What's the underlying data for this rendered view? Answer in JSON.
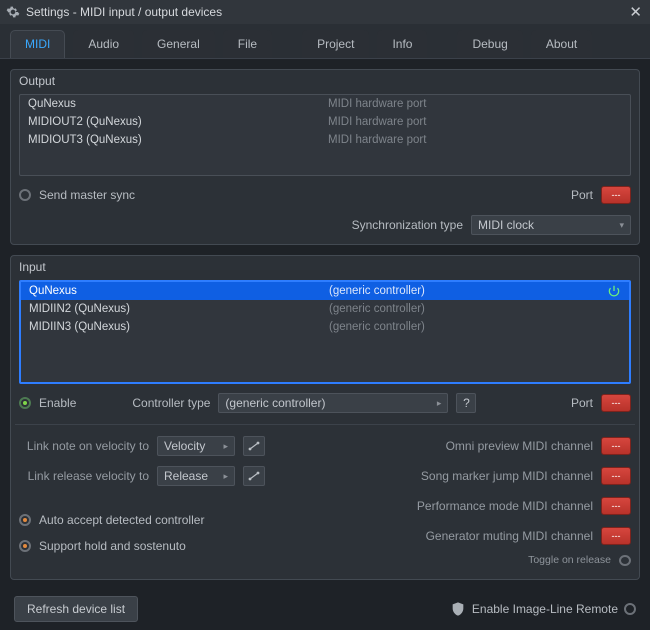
{
  "title": "Settings - MIDI input / output devices",
  "tabs": [
    "MIDI",
    "Audio",
    "General",
    "File",
    "Project",
    "Info",
    "Debug",
    "About"
  ],
  "active_tab": "MIDI",
  "output": {
    "title": "Output",
    "rows": [
      {
        "name": "QuNexus",
        "desc": "MIDI hardware port"
      },
      {
        "name": "MIDIOUT2 (QuNexus)",
        "desc": "MIDI hardware port"
      },
      {
        "name": "MIDIOUT3 (QuNexus)",
        "desc": "MIDI hardware port"
      }
    ],
    "send_master_sync": "Send master sync",
    "port_label": "Port",
    "port_value": "---",
    "sync_type_label": "Synchronization type",
    "sync_type_value": "MIDI clock"
  },
  "input": {
    "title": "Input",
    "rows": [
      {
        "name": "QuNexus",
        "desc": "(generic controller)",
        "selected": true
      },
      {
        "name": "MIDIIN2 (QuNexus)",
        "desc": "(generic controller)"
      },
      {
        "name": "MIDIIN3 (QuNexus)",
        "desc": "(generic controller)"
      }
    ],
    "enable_label": "Enable",
    "controller_type_label": "Controller type",
    "controller_type_value": "(generic controller)",
    "port_label": "Port",
    "port_value": "---",
    "link_note_on_label": "Link note on velocity to",
    "link_note_on_value": "Velocity",
    "link_release_label": "Link release velocity to",
    "link_release_value": "Release",
    "auto_accept": "Auto accept detected controller",
    "support_hold": "Support hold and sostenuto",
    "omni_preview": "Omni preview",
    "song_marker": "Song marker jump",
    "perf_mode": "Performance mode",
    "gen_muting": "Generator muting",
    "midi_channel": "MIDI channel",
    "midi_channel_value": "---",
    "toggle_release": "Toggle on release"
  },
  "refresh": "Refresh device list",
  "remote": "Enable Image-Line Remote"
}
